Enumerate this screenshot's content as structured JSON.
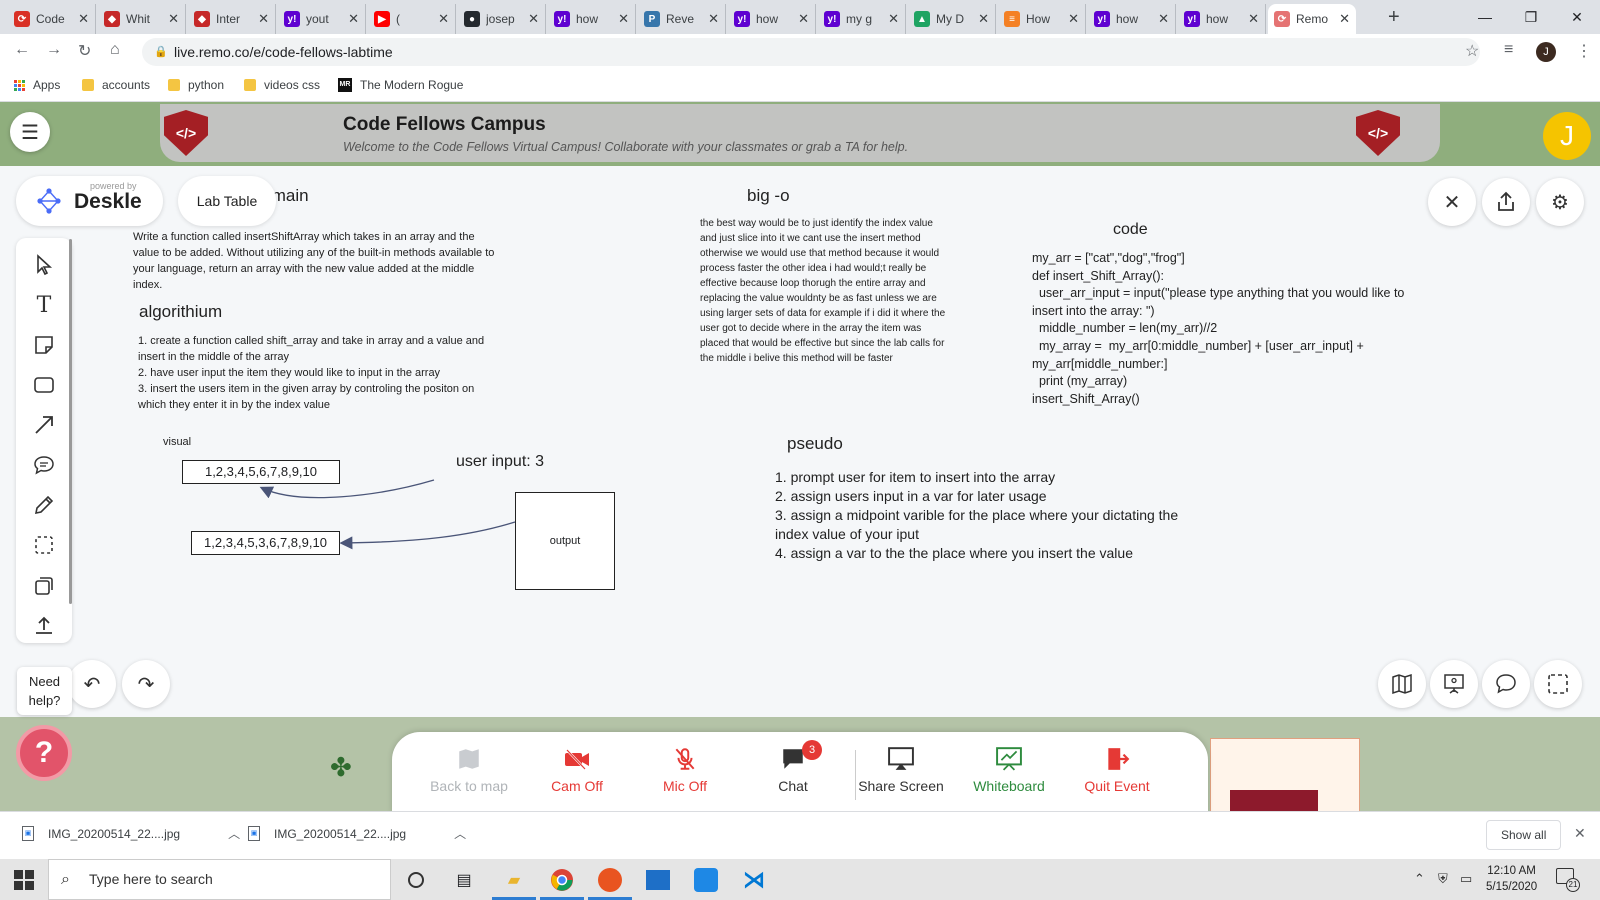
{
  "browser": {
    "tabs": [
      {
        "label": "Code",
        "icon": "remo-icon",
        "color": "#d93025",
        "glyph": "⟳"
      },
      {
        "label": "Whit",
        "icon": "shield-icon",
        "color": "#c62828",
        "glyph": "◆"
      },
      {
        "label": "Inter",
        "icon": "shield-icon",
        "color": "#c62828",
        "glyph": "◆"
      },
      {
        "label": "yout",
        "icon": "yahoo-icon",
        "color": "#5f01d1",
        "glyph": "y!"
      },
      {
        "label": "(",
        "icon": "youtube-icon",
        "color": "#ff0000",
        "glyph": "▶"
      },
      {
        "label": "josep",
        "icon": "github-icon",
        "color": "#24292e",
        "glyph": "●"
      },
      {
        "label": "how",
        "icon": "yahoo-icon",
        "color": "#5f01d1",
        "glyph": "y!"
      },
      {
        "label": "Reve",
        "icon": "python-icon",
        "color": "#3776ab",
        "glyph": "P"
      },
      {
        "label": "how",
        "icon": "yahoo-icon",
        "color": "#5f01d1",
        "glyph": "y!"
      },
      {
        "label": "my g",
        "icon": "yahoo-icon",
        "color": "#5f01d1",
        "glyph": "y!"
      },
      {
        "label": "My D",
        "icon": "drive-icon",
        "color": "#1fa463",
        "glyph": "▲"
      },
      {
        "label": "How",
        "icon": "stackoverflow-icon",
        "color": "#f48024",
        "glyph": "≡"
      },
      {
        "label": "how",
        "icon": "yahoo-icon",
        "color": "#5f01d1",
        "glyph": "y!"
      },
      {
        "label": "how",
        "icon": "yahoo-icon",
        "color": "#5f01d1",
        "glyph": "y!"
      },
      {
        "label": "Remo",
        "icon": "remo-icon",
        "color": "#e57373",
        "glyph": "⟳"
      }
    ],
    "url": "live.remo.co/e/code-fellows-labtime",
    "profile_initial": "J",
    "bookmarks": [
      {
        "label": "Apps"
      },
      {
        "label": "accounts"
      },
      {
        "label": "python"
      },
      {
        "label": "videos css"
      },
      {
        "label": "The Modern Rogue"
      }
    ]
  },
  "campus": {
    "title": "Code Fellows Campus",
    "subtitle": "Welcome to the Code Fellows Virtual Campus! Collaborate with your classmates or grab a TA for help.",
    "logo_text": "</>",
    "user_initial": "J"
  },
  "deskle": {
    "powered_by": "powered by",
    "name": "Deskle",
    "table_label": "Lab Table"
  },
  "whiteboard": {
    "problem_heading": "Problem Domain",
    "problem_text": "Write a function called insertShiftArray which takes in an array and the value to be added. Without utilizing any of the built-in methods available to your language, return an array with the new value added at the middle index.",
    "algorithm_heading": "algorithium",
    "algorithm_lines": [
      "1. create a function called shift_array and take in array and a value and insert in the middle of the array",
      "2. have user input the item they would like to input in the array",
      "3. insert the users item in the given array by controling the positon on which they enter it in by the index value"
    ],
    "visual_label": "visual",
    "box_before": "1,2,3,4,5,6,7,8,9,10",
    "box_after": "1,2,3,4,5,3,6,7,8,9,10",
    "user_input_label": "user input: 3",
    "output_label": "output",
    "bigo_heading": "big -o",
    "bigo_text": "the best way would be to just identify the index value and just slice into it we cant use the insert method otherwise we would use that method because it would process faster the other idea i  had would;t really be effective because loop thorugh the entire array and replacing the value wouldnty be as fast unless we are using larger sets of data for example if i did it where the user got to decide where in the array the item was placed that would be effective but since the lab calls for the middle i belive this method will be faster",
    "code_heading": "code",
    "code_text": "my_arr = [\"cat\",\"dog\",\"frog\"]\ndef insert_Shift_Array():\n  user_arr_input = input(\"please type anything that you would like to insert into the array: \")\n  middle_number = len(my_arr)//2\n  my_array =  my_arr[0:middle_number] + [user_arr_input] + my_arr[middle_number:]\n  print (my_array)\ninsert_Shift_Array()",
    "pseudo_heading": "pseudo",
    "pseudo_lines": [
      "1.  prompt user for item to insert into the array",
      "2. assign users input in a var for later usage",
      "3. assign a midpoint varible for the place where your dictating the index value of your iput",
      "4. assign a var to the the place where you insert the value"
    ]
  },
  "help": {
    "label": "Need help?"
  },
  "dock": {
    "items": [
      {
        "label": "Back to map",
        "color": "#b0b4b8"
      },
      {
        "label": "Cam Off",
        "color": "#e53935"
      },
      {
        "label": "Mic Off",
        "color": "#e53935"
      },
      {
        "label": "Chat",
        "color": "#333333"
      },
      {
        "label": "Share Screen",
        "color": "#333333"
      },
      {
        "label": "Whiteboard",
        "color": "#2e8b3e"
      },
      {
        "label": "Quit Event",
        "color": "#e53935"
      }
    ],
    "chat_badge": "3"
  },
  "downloads": {
    "items": [
      {
        "name": "IMG_20200514_22....jpg"
      },
      {
        "name": "IMG_20200514_22....jpg"
      }
    ],
    "show_all": "Show all"
  },
  "taskbar": {
    "search_placeholder": "Type here to search",
    "time": "12:10 AM",
    "date": "5/15/2020",
    "notifications": "21"
  }
}
